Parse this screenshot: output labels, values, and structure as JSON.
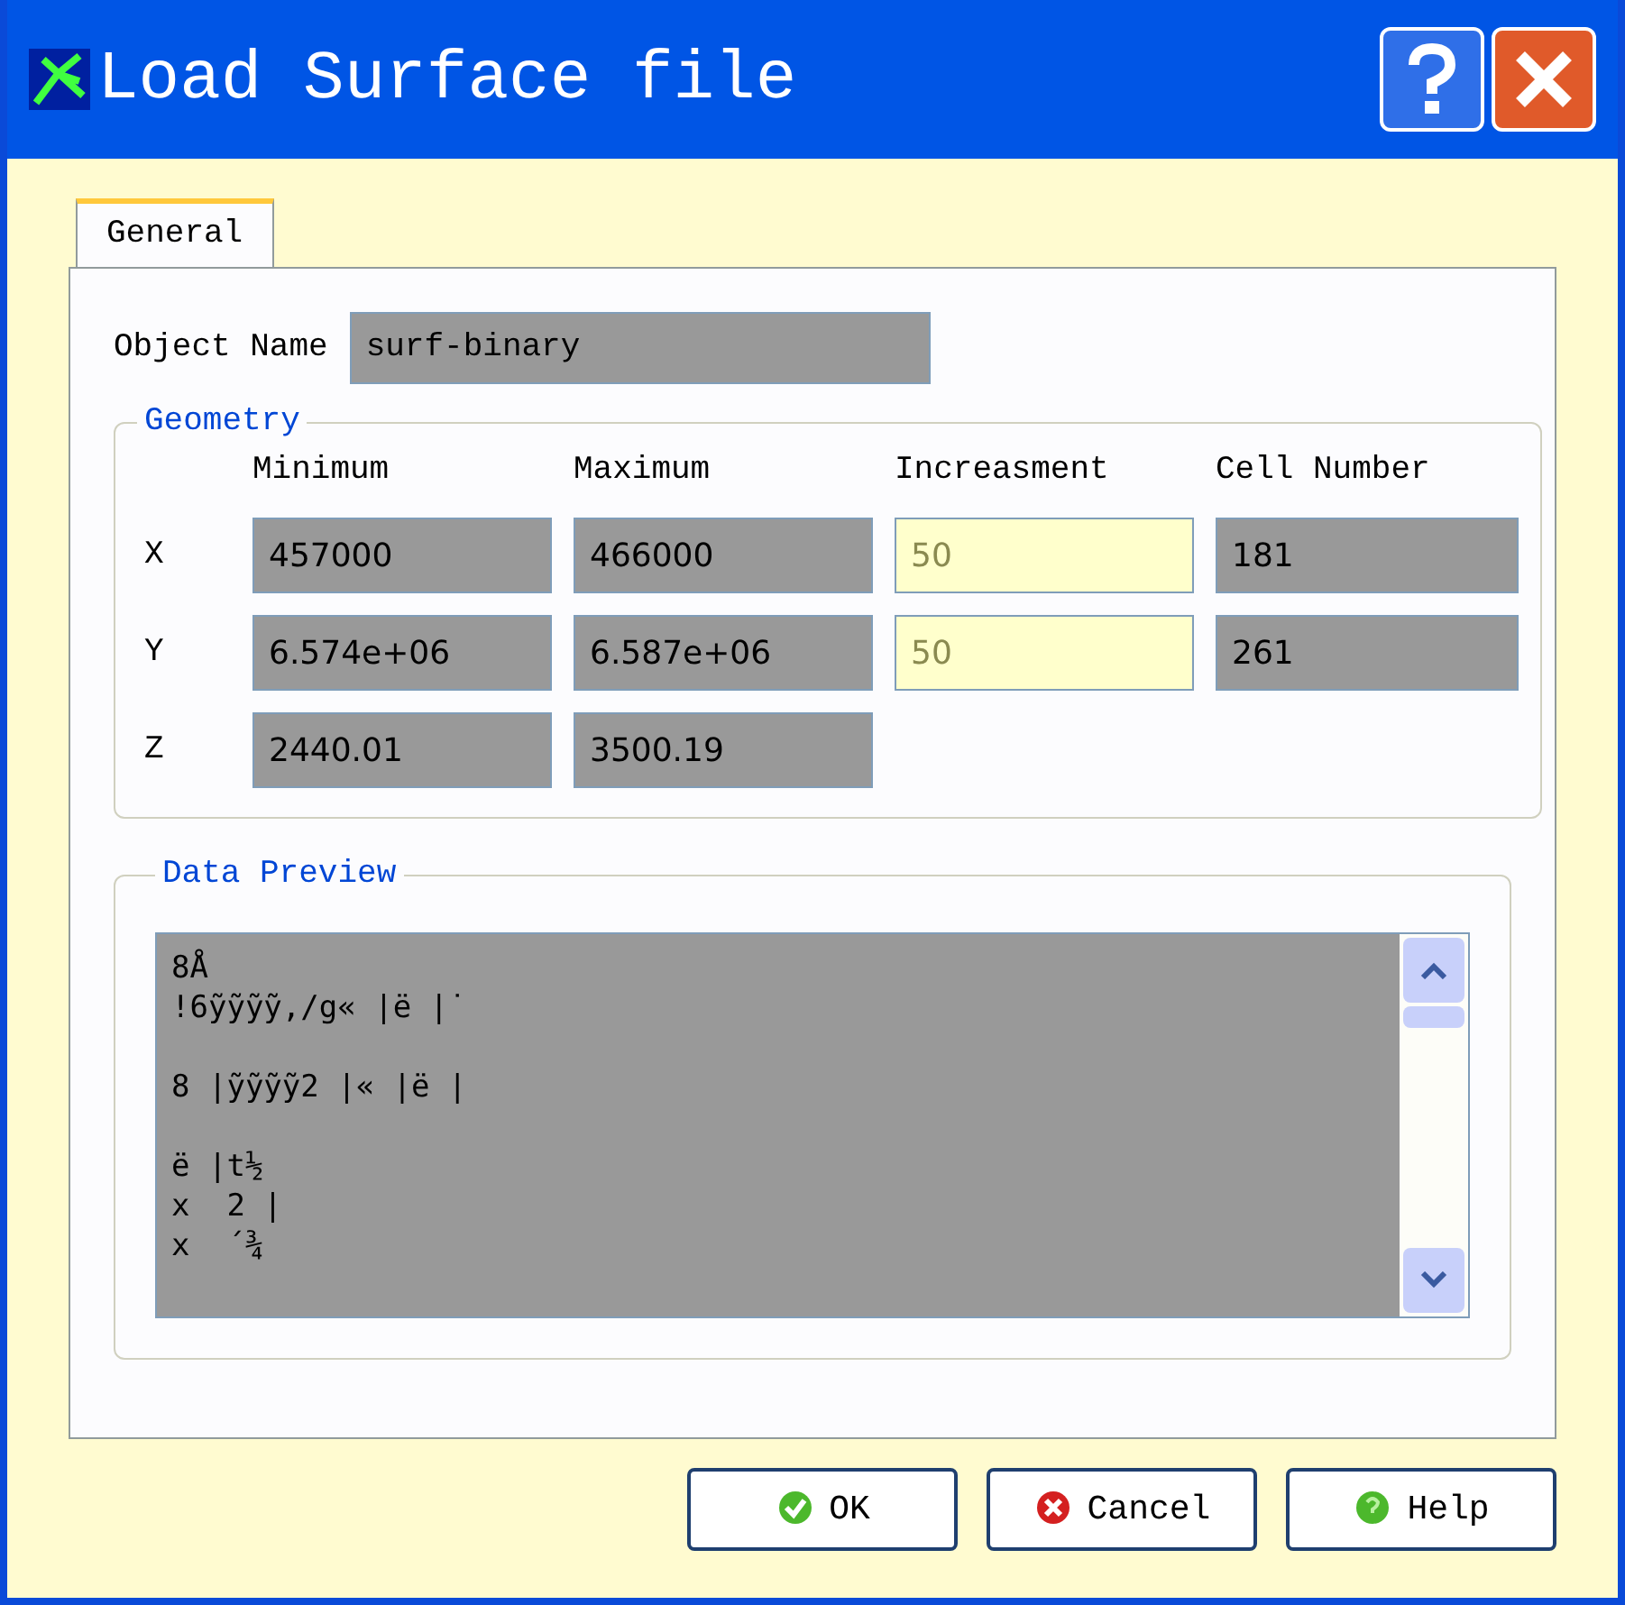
{
  "window": {
    "title": "Load Surface file"
  },
  "tabs": [
    {
      "label": "General",
      "selected": true
    }
  ],
  "object_name": {
    "label": "Object Name",
    "value": "surf-binary"
  },
  "geometry": {
    "title": "Geometry",
    "columns": [
      "Minimum",
      "Maximum",
      "Increasment",
      "Cell Number"
    ],
    "rows": [
      {
        "axis": "X",
        "fields": [
          {
            "value": "457000",
            "editable": false
          },
          {
            "value": "466000",
            "editable": false
          },
          {
            "value": "50",
            "editable": true
          },
          {
            "value": "181",
            "editable": false
          }
        ]
      },
      {
        "axis": "Y",
        "fields": [
          {
            "value": "6.574e+06",
            "editable": false
          },
          {
            "value": "6.587e+06",
            "editable": false
          },
          {
            "value": "50",
            "editable": true
          },
          {
            "value": "261",
            "editable": false
          }
        ]
      },
      {
        "axis": "Z",
        "fields": [
          {
            "value": "2440.01",
            "editable": false
          },
          {
            "value": "3500.19",
            "editable": false
          }
        ]
      }
    ]
  },
  "data_preview": {
    "title": "Data Preview",
    "paragraphs": [
      [
        "8Å",
        "!6ỹỹỹỹ,/g« |ë |˙"
      ],
      [
        "8 |ỹỹỹỹ2 |« |ë |"
      ],
      [
        "ë |t½",
        "x  2 |",
        "x  ´¾"
      ]
    ]
  },
  "buttons": [
    {
      "label": "OK",
      "kind": "ok"
    },
    {
      "label": "Cancel",
      "kind": "cancel"
    },
    {
      "label": "Help",
      "kind": "help"
    }
  ]
}
